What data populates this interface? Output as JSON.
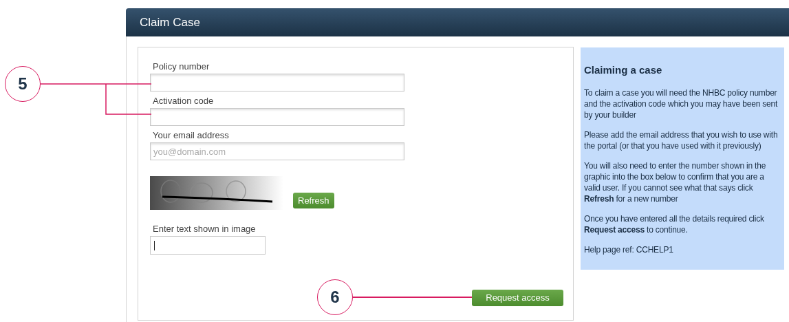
{
  "panel": {
    "title": "Claim Case"
  },
  "form": {
    "fields": [
      {
        "label": "Policy number"
      },
      {
        "label": "Activation code"
      },
      {
        "label": "Your email address",
        "placeholder": "you@domain.com"
      }
    ],
    "captcha": {
      "kind": "picture",
      "button": "Refresh"
    },
    "code_field": {
      "label": "Enter text shown in image"
    },
    "submit": "Request access"
  },
  "help": {
    "title": "Claiming a case",
    "paragraphs": [
      "To claim a case you will need the NHBC policy number and the activation code which you may have been sent by your builder",
      "Please add the email address that you wish to use with the portal (or that you have used with it previously)",
      "You will also need to enter the number shown in the graphic into the box below to confirm that you are a valid user. If you cannot see what that says click **Refresh** for a new number",
      "Once you have entered all the details required click **Request access** to continue.",
      "Help page ref: CCHELP1"
    ]
  },
  "callouts": [
    {
      "number": "5"
    },
    {
      "number": "6"
    }
  ]
}
